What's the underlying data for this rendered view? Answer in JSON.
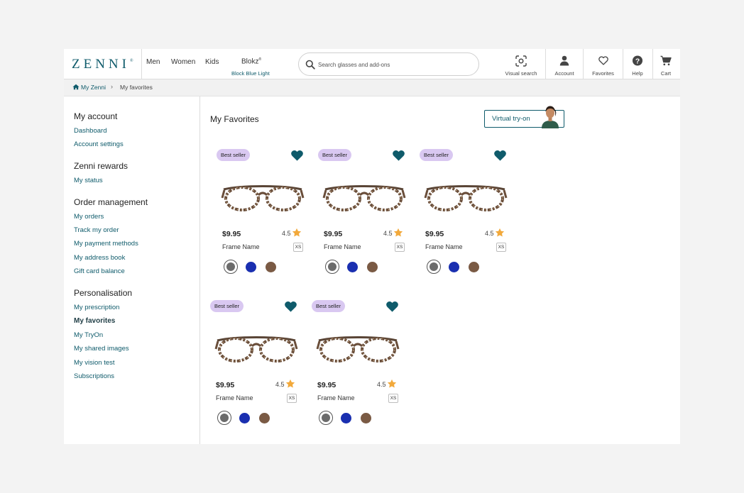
{
  "header": {
    "logo": "ZENNI",
    "logo_mark": "®",
    "nav": {
      "men": "Men",
      "women": "Women",
      "kids": "Kids",
      "blokz": "Blokz",
      "blokz_mark": "®",
      "blokz_sub": "Block Blue Light"
    },
    "search_placeholder": "Search glasses and add-ons",
    "icons": [
      {
        "label": "Visual search",
        "icon": "camera-scan-icon"
      },
      {
        "label": "Account",
        "icon": "user-icon"
      },
      {
        "label": "Favorites",
        "icon": "heart-outline-icon"
      },
      {
        "label": "Help",
        "icon": "help-icon"
      },
      {
        "label": "Cart",
        "icon": "cart-icon"
      }
    ]
  },
  "breadcrumb": {
    "home": "My Zenni",
    "separator": "›",
    "current": "My favorites"
  },
  "sidebar": {
    "sections": [
      {
        "title": "My account",
        "links": [
          "Dashboard",
          "Account settings"
        ]
      },
      {
        "title": "Zenni rewards",
        "links": [
          "My status"
        ]
      },
      {
        "title": "Order management",
        "links": [
          "My orders",
          "Track my order",
          "My payment methods",
          "My address book",
          "Gift card balance"
        ]
      },
      {
        "title": "Personalisation",
        "links": [
          "My prescription",
          "My favorites",
          "My TryOn",
          "My shared images",
          "My vision test",
          "Subscriptions"
        ]
      }
    ],
    "active_link": "My favorites"
  },
  "main": {
    "title": "My Favorites",
    "tryon_label": "Virtual try-on",
    "products": [
      {
        "badge": "Best seller",
        "price": "$9.95",
        "rating": "4.5",
        "name": "Frame Name",
        "size": "XS"
      },
      {
        "badge": "Best seller",
        "price": "$9.95",
        "rating": "4.5",
        "name": "Frame Name",
        "size": "XS"
      },
      {
        "badge": "Best seller",
        "price": "$9.95",
        "rating": "4.5",
        "name": "Frame Name",
        "size": "XS"
      },
      {
        "badge": "Best seller",
        "price": "$9.95",
        "rating": "4.5",
        "name": "Frame Name",
        "size": "XS"
      },
      {
        "badge": "Best seller",
        "price": "$9.95",
        "rating": "4.5",
        "name": "Frame Name",
        "size": "XS"
      }
    ],
    "swatch_colors": [
      "#6b6b6b",
      "#1a2fb0",
      "#7a5a44"
    ]
  },
  "colors": {
    "brand": "#0f5b6b",
    "badge": "#d9c8f1",
    "star": "#f2a93b",
    "heart": "#0f5b6b"
  }
}
